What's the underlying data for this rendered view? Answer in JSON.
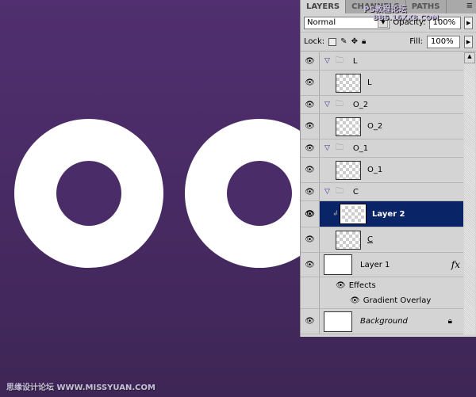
{
  "canvas": {
    "bg_top": "#512f70",
    "bg_bottom": "#3e2656",
    "ring_color": "#ffffff"
  },
  "panel": {
    "tabs": [
      {
        "label": "LAYERS",
        "active": true
      },
      {
        "label": "CHANNELS"
      },
      {
        "label": "PATHS"
      }
    ],
    "blend_mode": "Normal",
    "opacity_label": "Opacity:",
    "opacity": "100%",
    "lock_label": "Lock:",
    "fill_label": "Fill:",
    "fill": "100%",
    "layers": [
      {
        "type": "group",
        "name": "L"
      },
      {
        "type": "layer",
        "name": "L"
      },
      {
        "type": "group",
        "name": "O_2"
      },
      {
        "type": "layer",
        "name": "O_2"
      },
      {
        "type": "group",
        "name": "O_1"
      },
      {
        "type": "layer",
        "name": "O_1"
      },
      {
        "type": "group",
        "name": "C"
      },
      {
        "type": "layer",
        "name": "Layer 2",
        "selected": true,
        "clipped": true
      },
      {
        "type": "layer",
        "name": "C"
      }
    ],
    "layer1": {
      "name": "Layer 1",
      "fx": "fx",
      "effects_label": "Effects",
      "effect": "Gradient Overlay"
    },
    "background": {
      "name": "Background"
    },
    "selection_color": "#0a2468"
  },
  "watermarks": {
    "top": "PS教程论坛",
    "top2": "BBS.16XX8.COM",
    "bottom": "思缘设计论坛 WWW.MISSYUAN.COM"
  }
}
